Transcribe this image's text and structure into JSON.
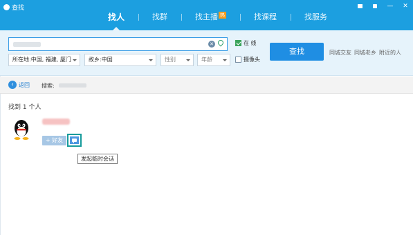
{
  "window": {
    "title": "查找",
    "buttons": [
      "skin-icon",
      "lock-icon",
      "minimize",
      "close"
    ],
    "minimize_glyph": "—",
    "close_glyph": "✕"
  },
  "tabs": [
    {
      "label": "找人",
      "active": true
    },
    {
      "label": "找群",
      "active": false
    },
    {
      "label": "找主播",
      "active": false,
      "badge": "热"
    },
    {
      "label": "找课程",
      "active": false
    },
    {
      "label": "找服务",
      "active": false
    }
  ],
  "search": {
    "keyword_placeholder": "",
    "online_label": "在  线",
    "online_checked": true,
    "camera_label": "摄像头",
    "camera_checked": false,
    "location": "所在地:中国, 福建, 厦门",
    "hometown": "故乡:中国",
    "gender": "性别",
    "age": "年龄",
    "find_button": "查找",
    "quick_links": [
      "同城交友",
      "同城老乡",
      "附近的人"
    ]
  },
  "nav": {
    "back_label": "返回",
    "search_label": "搜索:"
  },
  "results": {
    "count_text": "找到 1 个人",
    "add_friend_label": "+ 好友",
    "tooltip": "发起临时会话"
  },
  "colors": {
    "titlebar": "#1c9fe0",
    "panel": "#e6f3fb",
    "primary_button": "#1f8ee3",
    "highlight_border": "#169b9b"
  }
}
